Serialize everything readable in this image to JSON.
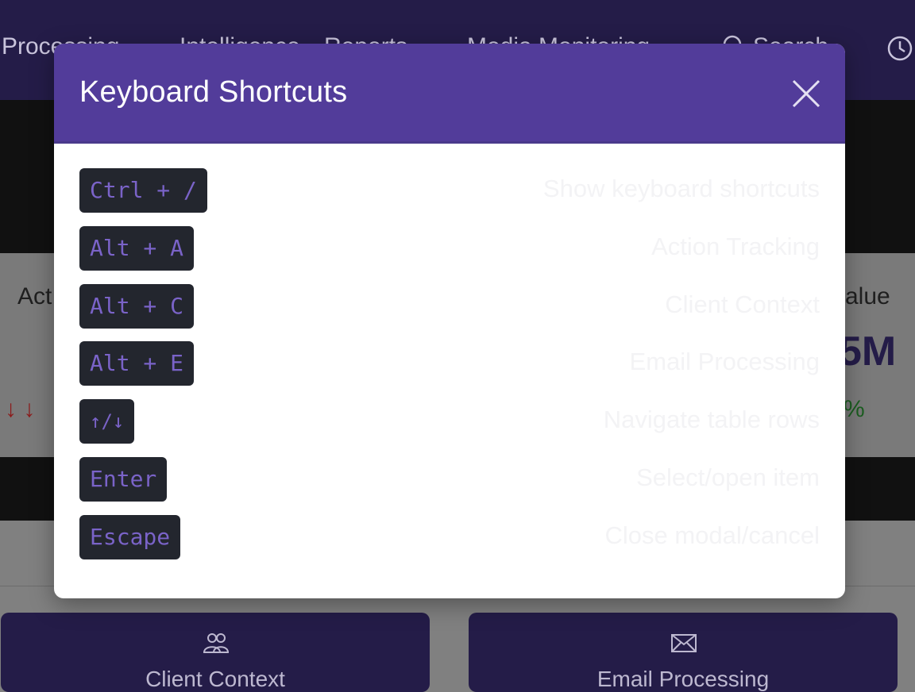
{
  "background": {
    "nav_items": [
      "Processing",
      "Intelligence",
      "Reports",
      "Media Monitoring",
      "Search"
    ],
    "stats": {
      "left_label": "Act",
      "right_label": "alue",
      "right_value": "5M",
      "right_change": "%",
      "down_arrows": "↓ ↓"
    },
    "cards": [
      {
        "label": "Client Context",
        "icon": "people-icon"
      },
      {
        "label": "Email Processing",
        "icon": "envelope-icon"
      }
    ]
  },
  "modal": {
    "title": "Keyboard Shortcuts",
    "close_icon": "close-icon",
    "shortcuts": [
      {
        "keys": "Ctrl + /",
        "description": "Show keyboard shortcuts"
      },
      {
        "keys": "Alt + A",
        "description": "Action Tracking"
      },
      {
        "keys": "Alt + C",
        "description": "Client Context"
      },
      {
        "keys": "Alt + E",
        "description": "Email Processing"
      },
      {
        "keys": "↑/↓",
        "description": "Navigate table rows"
      },
      {
        "keys": "Enter",
        "description": "Select/open item"
      },
      {
        "keys": "Escape",
        "description": "Close modal/cancel"
      }
    ]
  },
  "colors": {
    "header": "#523c9a",
    "nav": "#241c48",
    "kbd_bg": "#23262e",
    "kbd_text": "#7a63c8"
  }
}
